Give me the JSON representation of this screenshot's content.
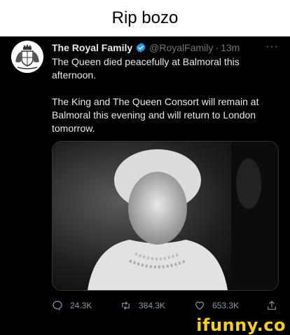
{
  "caption": "Rip bozo",
  "tweet": {
    "display_name": "The Royal Family",
    "handle": "@RoyalFamily",
    "separator": "·",
    "time": "13m",
    "more": "···",
    "paragraphs": [
      "The Queen died peacefully at Balmoral this afternoon.",
      "The King and The Queen Consort will remain at Balmoral this evening and will return to London tomorrow."
    ],
    "actions": {
      "replies": "24.3K",
      "retweets": "384.3K",
      "likes": "653.3K"
    }
  },
  "watermark": {
    "brand": "ifunny.co"
  },
  "colors": {
    "verified": "#1d9bf0",
    "brand": "#f4d019",
    "muted": "#71767b"
  },
  "icons": [
    "verified-badge-icon",
    "reply-icon",
    "retweet-icon",
    "like-icon",
    "share-icon",
    "royal-crest-icon"
  ]
}
